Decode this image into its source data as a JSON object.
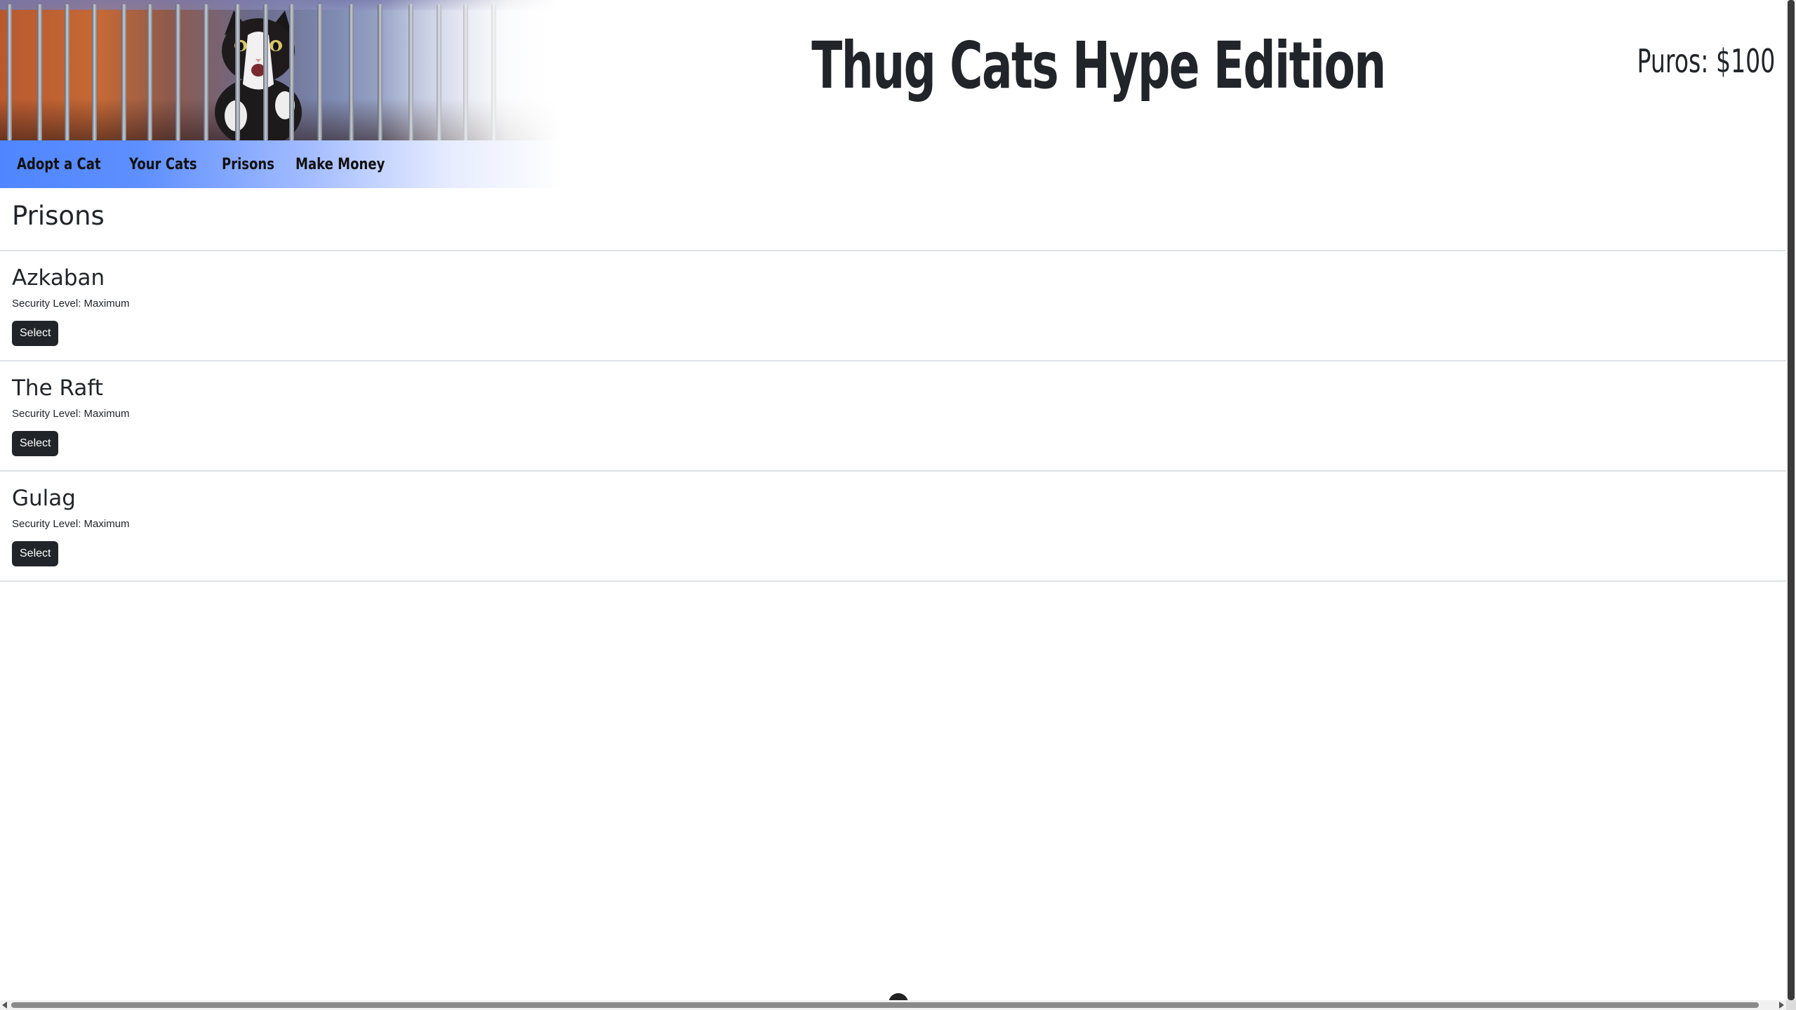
{
  "header": {
    "title": "Thug Cats Hype Edition",
    "balance": "Puros: $100",
    "banner_image": "cat-behind-bars-image"
  },
  "nav": {
    "items": [
      {
        "label": "Adopt a Cat"
      },
      {
        "label": "Your Cats"
      },
      {
        "label": "Prisons"
      },
      {
        "label": "Make Money"
      }
    ]
  },
  "main": {
    "page_title": "Prisons",
    "prisons": [
      {
        "name": "Azkaban",
        "security": "Security Level: Maximum",
        "button": "Select"
      },
      {
        "name": "The Raft",
        "security": "Security Level: Maximum",
        "button": "Select"
      },
      {
        "name": "Gulag",
        "security": "Security Level: Maximum",
        "button": "Select"
      }
    ]
  },
  "colors": {
    "nav_gradient_start": "#4f86ff",
    "button_bg": "#212529",
    "text": "#212529",
    "divider": "#dee2e6"
  }
}
